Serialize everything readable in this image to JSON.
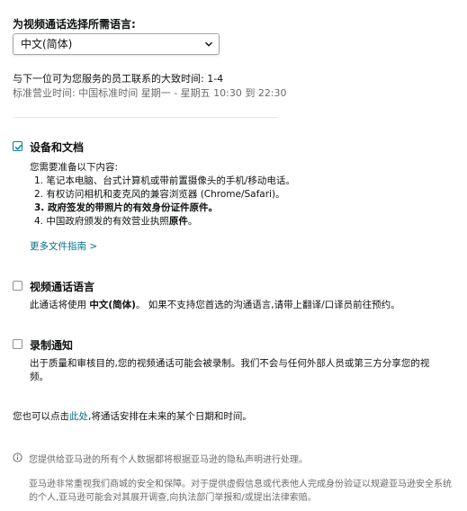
{
  "language": {
    "label": "为视频通话选择所需语言:",
    "selected": "中文(简体)"
  },
  "wait_time": {
    "prefix": "与下一位可为您服务的员工联系的大致时间:",
    "value": "1-4"
  },
  "business_hours": "标准营业时间: 中国标准时间 星期一 - 星期五 10:30 到 22:30",
  "documents": {
    "checked": true,
    "title": "设备和文档",
    "intro": "您需要准备以下内容:",
    "items": [
      {
        "text": "1. 笔记本电脑、台式计算机或带前置摄像头的手机/移动电话。"
      },
      {
        "text": "2. 有权访问相机和麦克风的兼容浏览器 (Chrome/Safari)。"
      },
      {
        "prefix": "3. ",
        "bold": "政府签发的带照片的有效身份证件原件。",
        "suffix": ""
      },
      {
        "prefix": "4. 中国政府颁发的有效营业执照",
        "bold": "原件",
        "suffix": "。"
      }
    ],
    "more_link": "更多文件指南 >"
  },
  "call_language": {
    "checked": false,
    "title": "视频通话语言",
    "prefix": "此通话将使用 ",
    "language": "中文(简体)",
    "suffix": "。 如果不支持您首选的沟通语言,请带上翻译/口译员前往预约。"
  },
  "recording": {
    "checked": false,
    "title": "录制通知",
    "text": "出于质量和审核目的,您的视频通话可能会被录制。我们不会与任何外部人员或第三方分享您的视频。"
  },
  "schedule": {
    "prefix": "您也可以点击",
    "link": "此处",
    "suffix": ",将通话安排在未来的某个日期和时间。"
  },
  "privacy_notice": "您提供给亚马逊的所有个人数据都将根据亚马逊的隐私声明进行处理。",
  "security_notice": "亚马逊非常重视我们商城的安全和保障。对于提供虚假信息或代表他人完成身份验证以规避亚马逊安全系统的个人,亚马逊可能会对其展开调查,向执法部门举报和/或提出法律索赔。",
  "colors": {
    "link": "#007185",
    "checkbox_checked": "#0a7c91",
    "muted_text": "#6b6b6b"
  }
}
